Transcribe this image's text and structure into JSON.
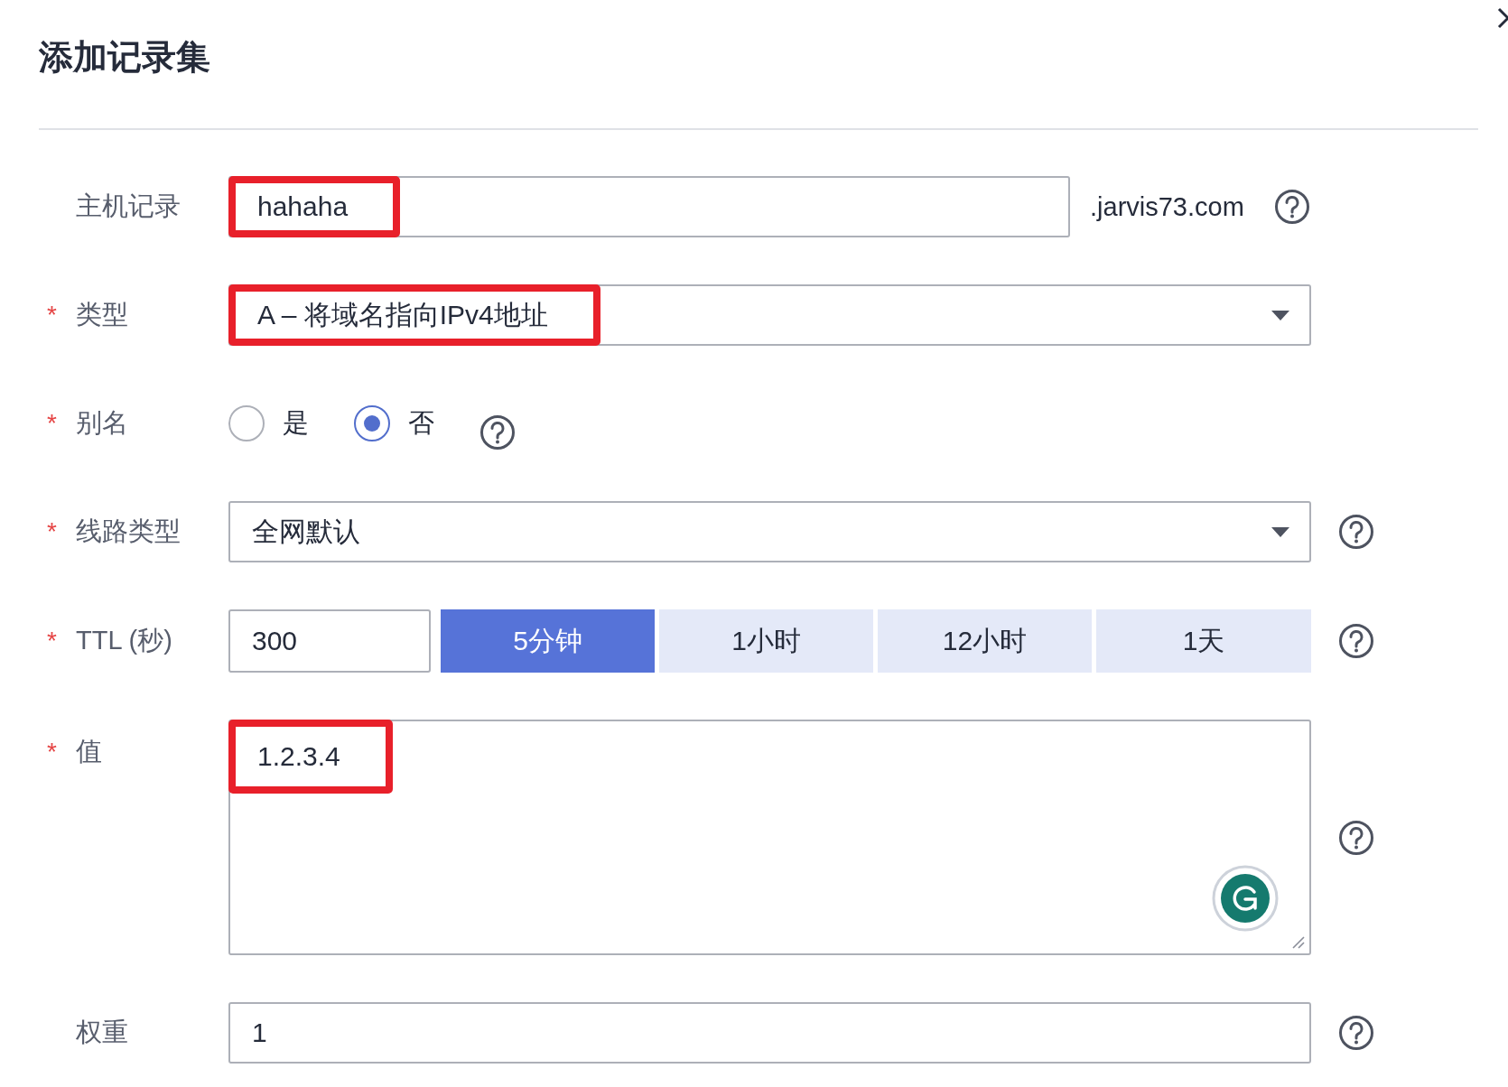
{
  "dialog": {
    "title": "添加记录集",
    "closable": true
  },
  "fields": [
    {
      "kind": "text",
      "label": "主机记录",
      "value": "hahaha",
      "highlighted": true,
      "suffix": ".jarvis73.com",
      "help": true
    },
    {
      "kind": "select",
      "label": "类型",
      "required_mark": "*",
      "value": "A – 将域名指向IPv4地址",
      "highlighted": true
    },
    {
      "kind": "radio",
      "label": "别名",
      "required_mark": "*",
      "options": [
        {
          "label": "是",
          "selected": false
        },
        {
          "label": "否",
          "selected": true
        }
      ],
      "help": true
    },
    {
      "kind": "select",
      "label": "线路类型",
      "required_mark": "*",
      "value": "全网默认",
      "highlighted": false,
      "help": true
    },
    {
      "kind": "ttl",
      "label": "TTL (秒)",
      "required_mark": "*",
      "value": "300",
      "presets": [
        {
          "label": "5分钟",
          "selected": true
        },
        {
          "label": "1小时",
          "selected": false
        },
        {
          "label": "12小时",
          "selected": false
        },
        {
          "label": "1天",
          "selected": false
        }
      ],
      "help": true
    },
    {
      "kind": "textarea",
      "label": "值",
      "required_mark": "*",
      "value": "1.2.3.4",
      "highlighted": true,
      "help": true
    },
    {
      "kind": "text",
      "label": "权重",
      "value": "1",
      "highlighted": false,
      "help": true
    }
  ]
}
